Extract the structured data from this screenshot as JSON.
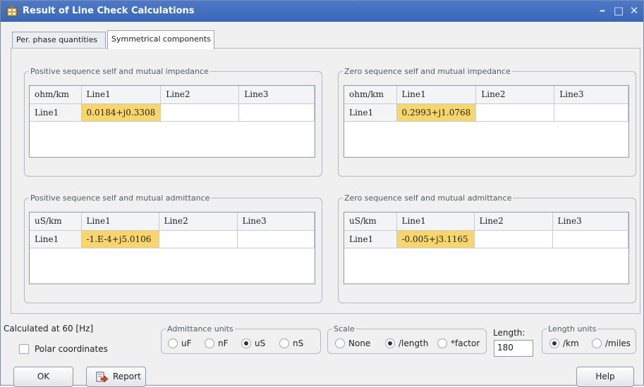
{
  "window": {
    "title": "Result of Line Check Calculations",
    "controls": {
      "minimize": "–",
      "maximize": "□",
      "close": "✕"
    }
  },
  "tabs": [
    {
      "label": "Per. phase quantities",
      "active": false
    },
    {
      "label": "Symmetrical components",
      "active": true
    }
  ],
  "groups": {
    "pos_impedance": {
      "legend": "Positive sequence self and mutual impedance",
      "header": [
        "ohm/km",
        "Line1",
        "Line2",
        "Line3"
      ],
      "rows": [
        {
          "name": "Line1",
          "cells": [
            "0.0184+j0.3308",
            "",
            ""
          ]
        }
      ]
    },
    "zero_impedance": {
      "legend": "Zero sequence self and mutual impedance",
      "header": [
        "ohm/km",
        "Line1",
        "Line2",
        "Line3"
      ],
      "rows": [
        {
          "name": "Line1",
          "cells": [
            "0.2993+j1.0768",
            "",
            ""
          ]
        }
      ]
    },
    "pos_admittance": {
      "legend": "Positive sequence self and mutual admittance",
      "header": [
        "uS/km",
        "Line1",
        "Line2",
        "Line3"
      ],
      "rows": [
        {
          "name": "Line1",
          "cells": [
            "-1.E-4+j5.0106",
            "",
            ""
          ]
        }
      ]
    },
    "zero_admittance": {
      "legend": "Zero sequence self and mutual admittance",
      "header": [
        "uS/km",
        "Line1",
        "Line2",
        "Line3"
      ],
      "rows": [
        {
          "name": "Line1",
          "cells": [
            "-0.005+j3.1165",
            "",
            ""
          ]
        }
      ]
    }
  },
  "footer": {
    "calculated_at": "Calculated at 60 [Hz]",
    "polar_label": "Polar coordinates",
    "polar_checked": false,
    "admittance_units": {
      "legend": "Admittance units",
      "options": [
        "uF",
        "nF",
        "uS",
        "nS"
      ],
      "selected": "uS"
    },
    "scale": {
      "legend": "Scale",
      "options": [
        "None",
        "/length",
        "*factor"
      ],
      "selected": "/length"
    },
    "length_label": "Length:",
    "length_value": "180",
    "length_units": {
      "legend": "Length units",
      "options": [
        "/km",
        "/miles"
      ],
      "selected": "/km"
    },
    "ok_label": "OK",
    "report_label": "Report",
    "help_label": "Help"
  },
  "colors": {
    "title_bar": "#3f6dbf",
    "highlight_cell": "#f8d66c"
  },
  "icons": {
    "app": "calculator-grid-icon",
    "report": "report-arrow-icon"
  }
}
